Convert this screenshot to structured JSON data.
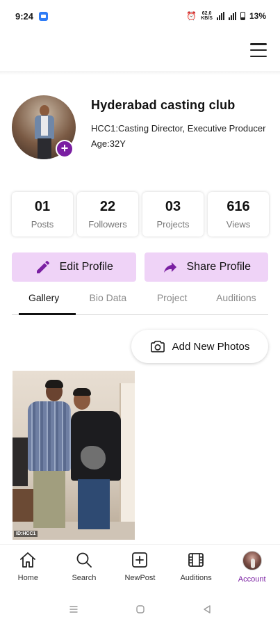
{
  "status_bar": {
    "time": "9:24",
    "net_speed_top": "62.0",
    "net_speed_bottom": "KB/S",
    "battery": "13%"
  },
  "profile": {
    "name": "Hyderabad casting club",
    "role": "HCC1:Casting Director, Executive Producer",
    "age": "Age:32Y"
  },
  "stats": [
    {
      "value": "01",
      "label": "Posts"
    },
    {
      "value": "22",
      "label": "Followers"
    },
    {
      "value": "03",
      "label": "Projects"
    },
    {
      "value": "616",
      "label": "Views"
    }
  ],
  "actions": {
    "edit_label": "Edit Profile",
    "share_label": "Share Profile"
  },
  "tabs": [
    {
      "label": "Gallery",
      "active": true
    },
    {
      "label": "Bio Data",
      "active": false
    },
    {
      "label": "Project",
      "active": false
    },
    {
      "label": "Auditions",
      "active": false
    }
  ],
  "gallery": {
    "add_photos_label": "Add New Photos",
    "watermark": "ID:HCC1"
  },
  "bottom_nav": [
    {
      "label": "Home",
      "icon": "home-icon"
    },
    {
      "label": "Search",
      "icon": "search-icon"
    },
    {
      "label": "NewPost",
      "icon": "new-post-icon"
    },
    {
      "label": "Auditions",
      "icon": "film-icon"
    },
    {
      "label": "Account",
      "icon": "account-avatar",
      "active": true
    }
  ],
  "colors": {
    "accent": "#7a1fa2",
    "button_bg": "#efd3f7"
  }
}
